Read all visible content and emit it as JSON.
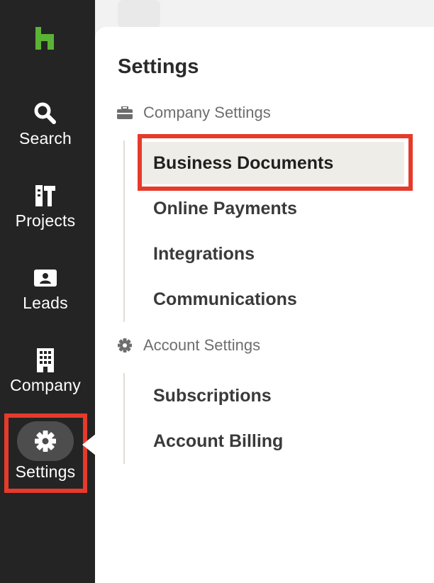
{
  "nav": {
    "logo_icon": "houzz-logo-icon",
    "items": [
      {
        "label": "Search",
        "icon": "search-icon"
      },
      {
        "label": "Projects",
        "icon": "projects-icon"
      },
      {
        "label": "Leads",
        "icon": "leads-icon"
      },
      {
        "label": "Company",
        "icon": "building-icon"
      },
      {
        "label": "Settings",
        "icon": "gear-icon",
        "active": true
      }
    ]
  },
  "panel": {
    "title": "Settings",
    "sections": [
      {
        "label": "Company Settings",
        "icon": "briefcase-icon",
        "items": [
          "Business Documents",
          "Online Payments",
          "Integrations",
          "Communications"
        ]
      },
      {
        "label": "Account Settings",
        "icon": "gear-icon",
        "items": [
          "Subscriptions",
          "Account Billing"
        ]
      }
    ],
    "selected_item": "Business Documents"
  },
  "colors": {
    "nav_bg": "#242424",
    "brand_green": "#5bb335",
    "highlight_red": "#e63a2b",
    "selected_bg": "#efede8"
  }
}
